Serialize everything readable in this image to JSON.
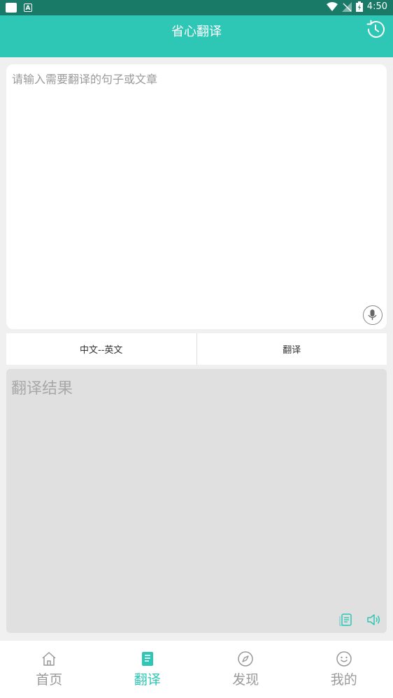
{
  "status_bar": {
    "time": "4:50"
  },
  "header": {
    "title": "省心翻译"
  },
  "input": {
    "placeholder": "请输入需要翻译的句子或文章"
  },
  "actions": {
    "language_pair": "中文--英文",
    "translate": "翻译"
  },
  "result": {
    "placeholder": "翻译结果"
  },
  "nav": {
    "items": [
      {
        "label": "首页",
        "icon": "home-icon",
        "active": false
      },
      {
        "label": "翻译",
        "icon": "translate-book-icon",
        "active": true
      },
      {
        "label": "发现",
        "icon": "compass-icon",
        "active": false
      },
      {
        "label": "我的",
        "icon": "smiley-icon",
        "active": false
      }
    ]
  },
  "colors": {
    "accent": "#2ec6b4",
    "status_bar": "#1a7a68",
    "inactive": "#999999",
    "result_bg": "#e0e0e0"
  }
}
